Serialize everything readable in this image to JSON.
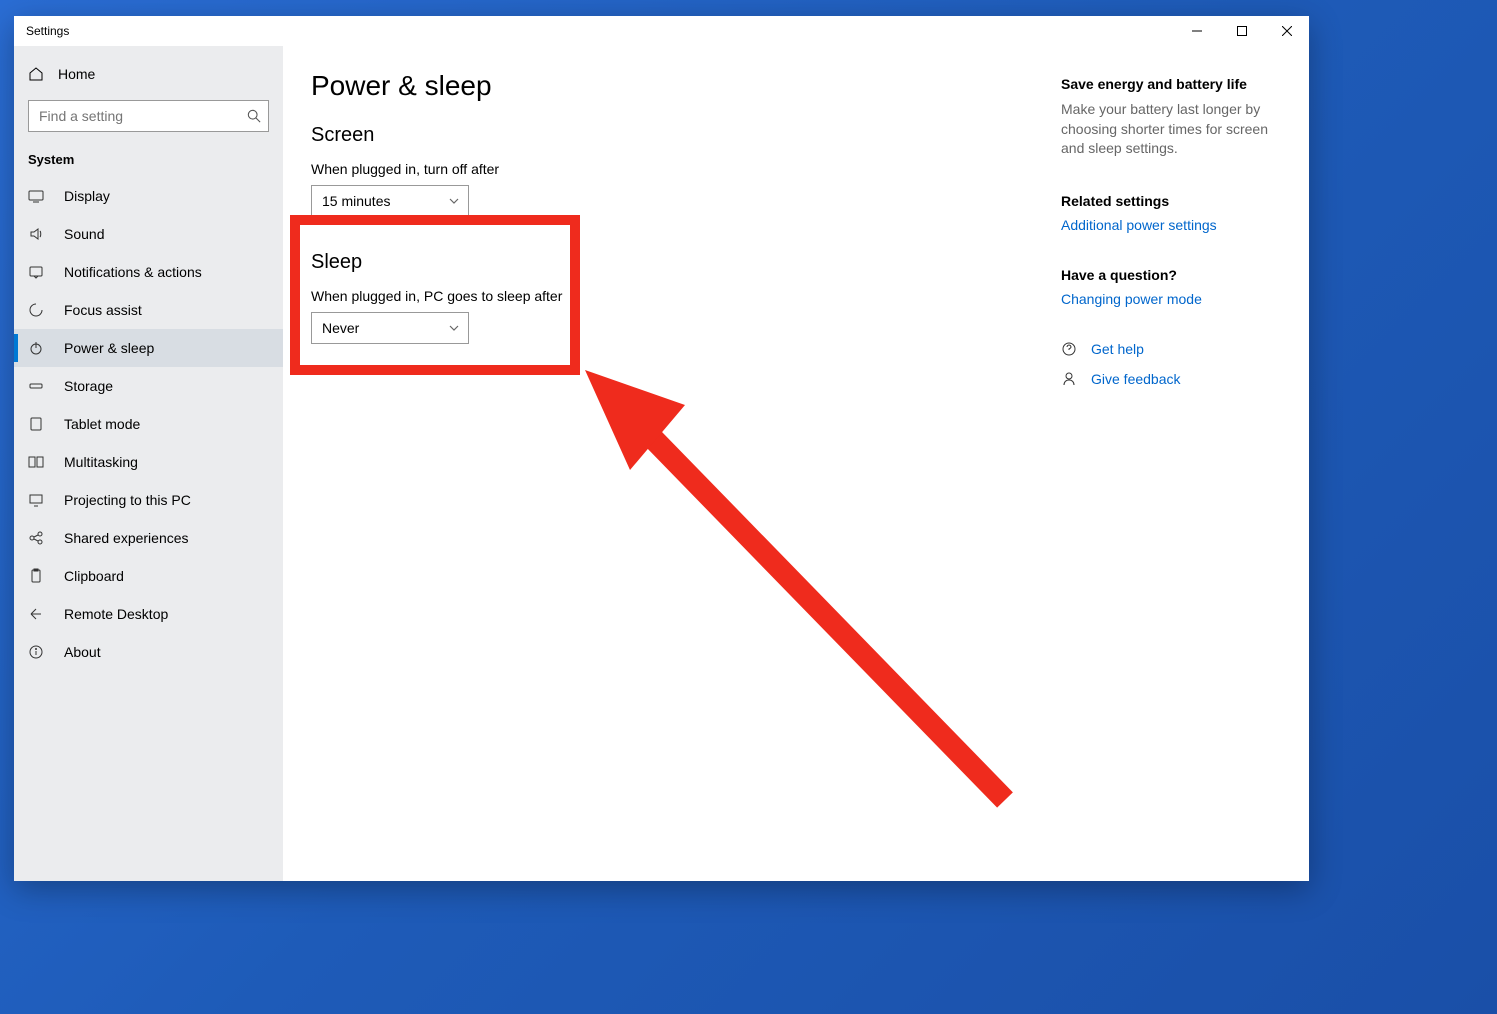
{
  "window": {
    "title": "Settings"
  },
  "sidebar": {
    "home": "Home",
    "search_placeholder": "Find a setting",
    "category": "System",
    "items": [
      {
        "label": "Display"
      },
      {
        "label": "Sound"
      },
      {
        "label": "Notifications & actions"
      },
      {
        "label": "Focus assist"
      },
      {
        "label": "Power & sleep"
      },
      {
        "label": "Storage"
      },
      {
        "label": "Tablet mode"
      },
      {
        "label": "Multitasking"
      },
      {
        "label": "Projecting to this PC"
      },
      {
        "label": "Shared experiences"
      },
      {
        "label": "Clipboard"
      },
      {
        "label": "Remote Desktop"
      },
      {
        "label": "About"
      }
    ]
  },
  "page": {
    "title": "Power & sleep",
    "screen": {
      "heading": "Screen",
      "label": "When plugged in, turn off after",
      "value": "15 minutes"
    },
    "sleep": {
      "heading": "Sleep",
      "label": "When plugged in, PC goes to sleep after",
      "value": "Never"
    }
  },
  "aside": {
    "energy_h": "Save energy and battery life",
    "energy_p": "Make your battery last longer by choosing shorter times for screen and sleep settings.",
    "related_h": "Related settings",
    "related_link": "Additional power settings",
    "question_h": "Have a question?",
    "question_link": "Changing power mode",
    "help": "Get help",
    "feedback": "Give feedback"
  }
}
